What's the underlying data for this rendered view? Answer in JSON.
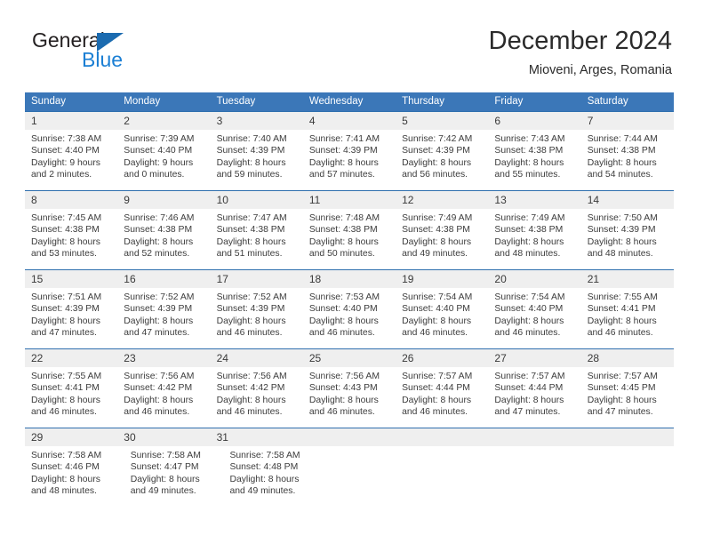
{
  "brand": {
    "name_top": "General",
    "name_bottom": "Blue",
    "triangle_color": "#1b6bb0",
    "blue_color": "#1b7fd4"
  },
  "header": {
    "title": "December 2024",
    "subtitle": "Mioveni, Arges, Romania"
  },
  "theme": {
    "header_bg": "#3b77b8",
    "header_text": "#ffffff",
    "row_separator": "#2f6fae",
    "daynum_bg": "#efefef",
    "body_text": "#3c3c3c"
  },
  "weekdays": [
    "Sunday",
    "Monday",
    "Tuesday",
    "Wednesday",
    "Thursday",
    "Friday",
    "Saturday"
  ],
  "weeks": [
    {
      "days": [
        {
          "num": "1",
          "sunrise": "Sunrise: 7:38 AM",
          "sunset": "Sunset: 4:40 PM",
          "daylight1": "Daylight: 9 hours",
          "daylight2": "and 2 minutes."
        },
        {
          "num": "2",
          "sunrise": "Sunrise: 7:39 AM",
          "sunset": "Sunset: 4:40 PM",
          "daylight1": "Daylight: 9 hours",
          "daylight2": "and 0 minutes."
        },
        {
          "num": "3",
          "sunrise": "Sunrise: 7:40 AM",
          "sunset": "Sunset: 4:39 PM",
          "daylight1": "Daylight: 8 hours",
          "daylight2": "and 59 minutes."
        },
        {
          "num": "4",
          "sunrise": "Sunrise: 7:41 AM",
          "sunset": "Sunset: 4:39 PM",
          "daylight1": "Daylight: 8 hours",
          "daylight2": "and 57 minutes."
        },
        {
          "num": "5",
          "sunrise": "Sunrise: 7:42 AM",
          "sunset": "Sunset: 4:39 PM",
          "daylight1": "Daylight: 8 hours",
          "daylight2": "and 56 minutes."
        },
        {
          "num": "6",
          "sunrise": "Sunrise: 7:43 AM",
          "sunset": "Sunset: 4:38 PM",
          "daylight1": "Daylight: 8 hours",
          "daylight2": "and 55 minutes."
        },
        {
          "num": "7",
          "sunrise": "Sunrise: 7:44 AM",
          "sunset": "Sunset: 4:38 PM",
          "daylight1": "Daylight: 8 hours",
          "daylight2": "and 54 minutes."
        }
      ]
    },
    {
      "days": [
        {
          "num": "8",
          "sunrise": "Sunrise: 7:45 AM",
          "sunset": "Sunset: 4:38 PM",
          "daylight1": "Daylight: 8 hours",
          "daylight2": "and 53 minutes."
        },
        {
          "num": "9",
          "sunrise": "Sunrise: 7:46 AM",
          "sunset": "Sunset: 4:38 PM",
          "daylight1": "Daylight: 8 hours",
          "daylight2": "and 52 minutes."
        },
        {
          "num": "10",
          "sunrise": "Sunrise: 7:47 AM",
          "sunset": "Sunset: 4:38 PM",
          "daylight1": "Daylight: 8 hours",
          "daylight2": "and 51 minutes."
        },
        {
          "num": "11",
          "sunrise": "Sunrise: 7:48 AM",
          "sunset": "Sunset: 4:38 PM",
          "daylight1": "Daylight: 8 hours",
          "daylight2": "and 50 minutes."
        },
        {
          "num": "12",
          "sunrise": "Sunrise: 7:49 AM",
          "sunset": "Sunset: 4:38 PM",
          "daylight1": "Daylight: 8 hours",
          "daylight2": "and 49 minutes."
        },
        {
          "num": "13",
          "sunrise": "Sunrise: 7:49 AM",
          "sunset": "Sunset: 4:38 PM",
          "daylight1": "Daylight: 8 hours",
          "daylight2": "and 48 minutes."
        },
        {
          "num": "14",
          "sunrise": "Sunrise: 7:50 AM",
          "sunset": "Sunset: 4:39 PM",
          "daylight1": "Daylight: 8 hours",
          "daylight2": "and 48 minutes."
        }
      ]
    },
    {
      "days": [
        {
          "num": "15",
          "sunrise": "Sunrise: 7:51 AM",
          "sunset": "Sunset: 4:39 PM",
          "daylight1": "Daylight: 8 hours",
          "daylight2": "and 47 minutes."
        },
        {
          "num": "16",
          "sunrise": "Sunrise: 7:52 AM",
          "sunset": "Sunset: 4:39 PM",
          "daylight1": "Daylight: 8 hours",
          "daylight2": "and 47 minutes."
        },
        {
          "num": "17",
          "sunrise": "Sunrise: 7:52 AM",
          "sunset": "Sunset: 4:39 PM",
          "daylight1": "Daylight: 8 hours",
          "daylight2": "and 46 minutes."
        },
        {
          "num": "18",
          "sunrise": "Sunrise: 7:53 AM",
          "sunset": "Sunset: 4:40 PM",
          "daylight1": "Daylight: 8 hours",
          "daylight2": "and 46 minutes."
        },
        {
          "num": "19",
          "sunrise": "Sunrise: 7:54 AM",
          "sunset": "Sunset: 4:40 PM",
          "daylight1": "Daylight: 8 hours",
          "daylight2": "and 46 minutes."
        },
        {
          "num": "20",
          "sunrise": "Sunrise: 7:54 AM",
          "sunset": "Sunset: 4:40 PM",
          "daylight1": "Daylight: 8 hours",
          "daylight2": "and 46 minutes."
        },
        {
          "num": "21",
          "sunrise": "Sunrise: 7:55 AM",
          "sunset": "Sunset: 4:41 PM",
          "daylight1": "Daylight: 8 hours",
          "daylight2": "and 46 minutes."
        }
      ]
    },
    {
      "days": [
        {
          "num": "22",
          "sunrise": "Sunrise: 7:55 AM",
          "sunset": "Sunset: 4:41 PM",
          "daylight1": "Daylight: 8 hours",
          "daylight2": "and 46 minutes."
        },
        {
          "num": "23",
          "sunrise": "Sunrise: 7:56 AM",
          "sunset": "Sunset: 4:42 PM",
          "daylight1": "Daylight: 8 hours",
          "daylight2": "and 46 minutes."
        },
        {
          "num": "24",
          "sunrise": "Sunrise: 7:56 AM",
          "sunset": "Sunset: 4:42 PM",
          "daylight1": "Daylight: 8 hours",
          "daylight2": "and 46 minutes."
        },
        {
          "num": "25",
          "sunrise": "Sunrise: 7:56 AM",
          "sunset": "Sunset: 4:43 PM",
          "daylight1": "Daylight: 8 hours",
          "daylight2": "and 46 minutes."
        },
        {
          "num": "26",
          "sunrise": "Sunrise: 7:57 AM",
          "sunset": "Sunset: 4:44 PM",
          "daylight1": "Daylight: 8 hours",
          "daylight2": "and 46 minutes."
        },
        {
          "num": "27",
          "sunrise": "Sunrise: 7:57 AM",
          "sunset": "Sunset: 4:44 PM",
          "daylight1": "Daylight: 8 hours",
          "daylight2": "and 47 minutes."
        },
        {
          "num": "28",
          "sunrise": "Sunrise: 7:57 AM",
          "sunset": "Sunset: 4:45 PM",
          "daylight1": "Daylight: 8 hours",
          "daylight2": "and 47 minutes."
        }
      ]
    },
    {
      "days": [
        {
          "num": "29",
          "sunrise": "Sunrise: 7:58 AM",
          "sunset": "Sunset: 4:46 PM",
          "daylight1": "Daylight: 8 hours",
          "daylight2": "and 48 minutes."
        },
        {
          "num": "30",
          "sunrise": "Sunrise: 7:58 AM",
          "sunset": "Sunset: 4:47 PM",
          "daylight1": "Daylight: 8 hours",
          "daylight2": "and 49 minutes."
        },
        {
          "num": "31",
          "sunrise": "Sunrise: 7:58 AM",
          "sunset": "Sunset: 4:48 PM",
          "daylight1": "Daylight: 8 hours",
          "daylight2": "and 49 minutes."
        },
        {
          "num": "",
          "sunrise": "",
          "sunset": "",
          "daylight1": "",
          "daylight2": ""
        },
        {
          "num": "",
          "sunrise": "",
          "sunset": "",
          "daylight1": "",
          "daylight2": ""
        },
        {
          "num": "",
          "sunrise": "",
          "sunset": "",
          "daylight1": "",
          "daylight2": ""
        },
        {
          "num": "",
          "sunrise": "",
          "sunset": "",
          "daylight1": "",
          "daylight2": ""
        }
      ]
    }
  ]
}
